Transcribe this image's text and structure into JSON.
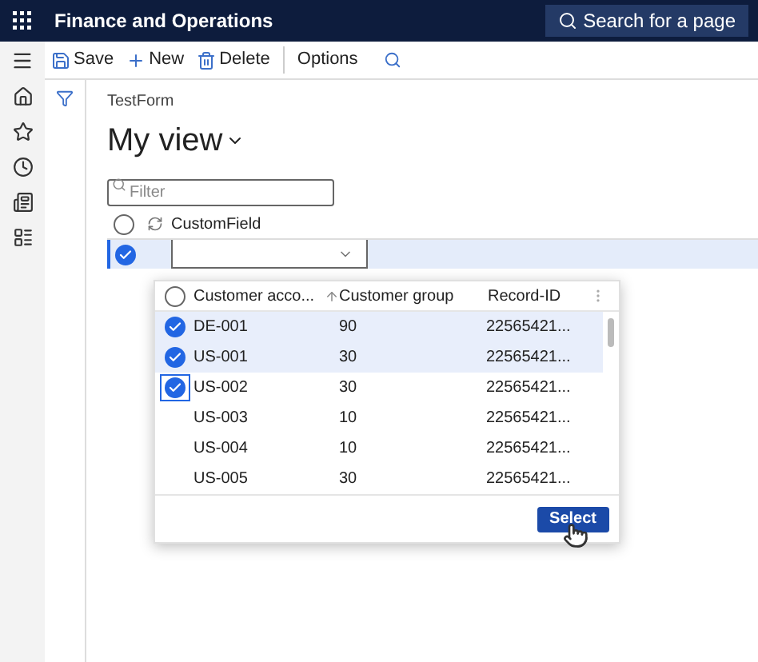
{
  "header": {
    "title": "Finance and Operations",
    "search": "Search for a page"
  },
  "toolbar": {
    "buttons": [
      "Save",
      "New",
      "Delete",
      "Options"
    ]
  },
  "page": {
    "caption": "TestForm",
    "view": "My view",
    "filter": {
      "placeholder": "Filter"
    }
  },
  "grid": {
    "columns": [
      "CustomField"
    ],
    "rows": [
      {
        "checked": true,
        "selected": true
      }
    ]
  },
  "lookup": {
    "columns": [
      "Customer acco...",
      "Customer group",
      "Record-ID"
    ],
    "rows": [
      {
        "account": "DE-001",
        "group": "90",
        "record": "22565421...",
        "checked": true,
        "selected": true,
        "focused": false
      },
      {
        "account": "US-001",
        "group": "30",
        "record": "22565421...",
        "checked": true,
        "selected": true,
        "focused": false
      },
      {
        "account": "US-002",
        "group": "30",
        "record": "22565421...",
        "checked": true,
        "selected": false,
        "focused": true
      },
      {
        "account": "US-003",
        "group": "10",
        "record": "22565421...",
        "checked": false,
        "selected": false,
        "focused": false
      },
      {
        "account": "US-004",
        "group": "10",
        "record": "22565421...",
        "checked": false,
        "selected": false,
        "focused": false
      },
      {
        "account": "US-005",
        "group": "30",
        "record": "22565421...",
        "checked": false,
        "selected": false,
        "focused": false
      }
    ],
    "button": "Select"
  }
}
